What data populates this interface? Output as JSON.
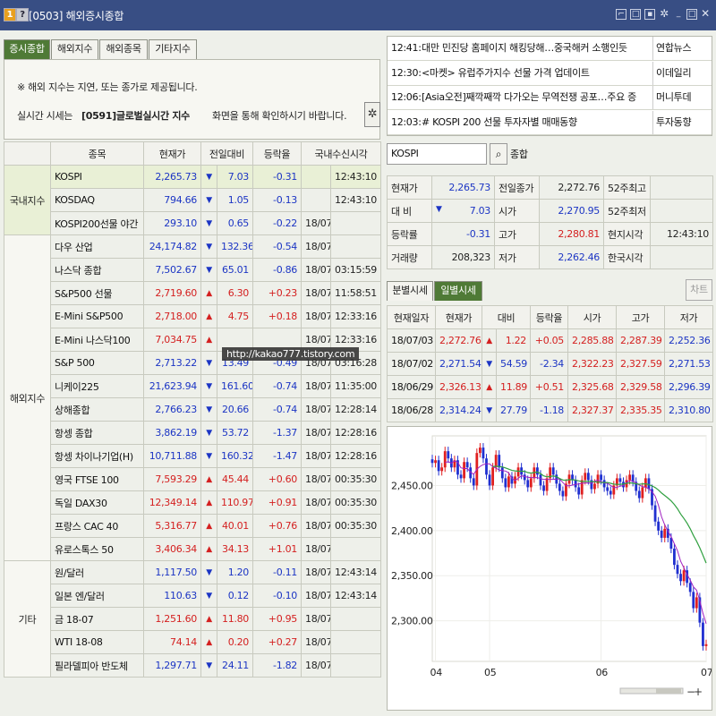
{
  "window": {
    "badge1": "1",
    "badge2": "?",
    "title": "[0503] 해외증시종합",
    "icons": [
      "pin-icon",
      "copy-icon",
      "save-icon",
      "settings-icon",
      "minimize-icon",
      "maximize-icon",
      "close-icon"
    ]
  },
  "tabs": [
    "증시종합",
    "해외지수",
    "해외종목",
    "기타지수"
  ],
  "notice": {
    "line1": "※ 해외 지수는 지연, 또는 종가로 제공됩니다.",
    "line2_prefix": "실시간 시세는",
    "line2_code": "[0591]글로벌실시간 지수",
    "line2_suffix": "화면을 통해 확인하시기 바랍니다."
  },
  "table": {
    "headers": [
      "종목",
      "현재가",
      "전일대비",
      "등락율",
      "국내수신시각"
    ],
    "groups": [
      {
        "label": "국내지수",
        "rows": [
          {
            "name": "KOSPI",
            "price": "2,265.73",
            "dir": "down",
            "change": "7.03",
            "rate": "-0.31",
            "date": "",
            "time": "12:43:10"
          },
          {
            "name": "KOSDAQ",
            "price": "794.66",
            "dir": "down",
            "change": "1.05",
            "rate": "-0.13",
            "date": "",
            "time": "12:43:10"
          },
          {
            "name": "KOSPI200선물 야간",
            "price": "293.10",
            "dir": "down",
            "change": "0.65",
            "rate": "-0.22",
            "date": "18/07/03",
            "time": ""
          }
        ]
      },
      {
        "label": "해외지수",
        "rows": [
          {
            "name": "다우 산업",
            "price": "24,174.82",
            "dir": "down",
            "change": "132.36",
            "rate": "-0.54",
            "date": "18/07/03",
            "time": ""
          },
          {
            "name": "나스닥 종합",
            "price": "7,502.67",
            "dir": "down",
            "change": "65.01",
            "rate": "-0.86",
            "date": "18/07/04",
            "time": "03:15:59"
          },
          {
            "name": "S&P500 선물",
            "price": "2,719.60",
            "dir": "up",
            "change": "6.30",
            "rate": "+0.23",
            "date": "18/07/04",
            "time": "11:58:51"
          },
          {
            "name": "E-Mini S&P500",
            "price": "2,718.00",
            "dir": "up",
            "change": "4.75",
            "rate": "+0.18",
            "date": "18/07/04",
            "time": "12:33:16"
          },
          {
            "name": "E-Mini 나스닥100",
            "price": "7,034.75",
            "dir": "up",
            "change": "",
            "rate": "",
            "date": "18/07/04",
            "time": "12:33:16"
          },
          {
            "name": "S&P 500",
            "price": "2,713.22",
            "dir": "down",
            "change": "13.49",
            "rate": "-0.49",
            "date": "18/07/04",
            "time": "03:16:28"
          },
          {
            "name": "니케이225",
            "price": "21,623.94",
            "dir": "down",
            "change": "161.60",
            "rate": "-0.74",
            "date": "18/07/04",
            "time": "11:35:00"
          },
          {
            "name": "상해종합",
            "price": "2,766.23",
            "dir": "down",
            "change": "20.66",
            "rate": "-0.74",
            "date": "18/07/04",
            "time": "12:28:14"
          },
          {
            "name": "항셍 종합",
            "price": "3,862.19",
            "dir": "down",
            "change": "53.72",
            "rate": "-1.37",
            "date": "18/07/04",
            "time": "12:28:16"
          },
          {
            "name": "항셍 차이나기업(H)",
            "price": "10,711.88",
            "dir": "down",
            "change": "160.32",
            "rate": "-1.47",
            "date": "18/07/04",
            "time": "12:28:16"
          },
          {
            "name": "영국 FTSE 100",
            "price": "7,593.29",
            "dir": "up",
            "change": "45.44",
            "rate": "+0.60",
            "date": "18/07/04",
            "time": "00:35:30"
          },
          {
            "name": "독일 DAX30",
            "price": "12,349.14",
            "dir": "up",
            "change": "110.97",
            "rate": "+0.91",
            "date": "18/07/04",
            "time": "00:35:30"
          },
          {
            "name": "프랑스 CAC 40",
            "price": "5,316.77",
            "dir": "up",
            "change": "40.01",
            "rate": "+0.76",
            "date": "18/07/04",
            "time": "00:35:30"
          },
          {
            "name": "유로스톡스 50",
            "price": "3,406.34",
            "dir": "up",
            "change": "34.13",
            "rate": "+1.01",
            "date": "18/07/03",
            "time": ""
          }
        ]
      },
      {
        "label": "기타",
        "rows": [
          {
            "name": "원/달러",
            "price": "1,117.50",
            "dir": "down",
            "change": "1.20",
            "rate": "-0.11",
            "date": "18/07/04",
            "time": "12:43:14"
          },
          {
            "name": "일본 엔/달러",
            "price": "110.63",
            "dir": "down",
            "change": "0.12",
            "rate": "-0.10",
            "date": "18/07/04",
            "time": "12:43:14"
          },
          {
            "name": "금 18-07",
            "price": "1,251.60",
            "dir": "up",
            "change": "11.80",
            "rate": "+0.95",
            "date": "18/07/03",
            "time": ""
          },
          {
            "name": "WTI 18-08",
            "price": "74.14",
            "dir": "up",
            "change": "0.20",
            "rate": "+0.27",
            "date": "18/07/03",
            "time": ""
          },
          {
            "name": "필라델피아 반도체",
            "price": "1,297.71",
            "dir": "down",
            "change": "24.11",
            "rate": "-1.82",
            "date": "18/07/03",
            "time": ""
          }
        ]
      }
    ]
  },
  "watermark": "http://kakao777.tistory.com",
  "news": [
    {
      "time": "12:41:",
      "title": "대만 민진당 홈페이지 해킹당해…중국해커 소행인듯",
      "source": "연합뉴스"
    },
    {
      "time": "12:30:",
      "title": "<마켓> 유럽주가지수 선물 가격 업데이트",
      "source": "이데일리"
    },
    {
      "time": "12:06:",
      "title": "[Asia오전]째깍째깍 다가오는 무역전쟁 공포…주요 증",
      "source": "머니투데"
    },
    {
      "time": "12:03:",
      "title": "# KOSPI 200 선물 투자자별 매매동향",
      "source": "투자동향"
    }
  ],
  "search": {
    "value": "KOSPI",
    "label": "종합"
  },
  "quote": {
    "rows": [
      [
        {
          "l": "현재가"
        },
        {
          "v": "2,265.73",
          "c": "dn"
        },
        {
          "l": "전일종가"
        },
        {
          "v": "2,272.76",
          "c": "neu"
        },
        {
          "l": "52주최고"
        },
        {
          "v": "",
          "c": "neu"
        }
      ],
      [
        {
          "l": "대 비"
        },
        {
          "v": "7.03",
          "c": "dn",
          "arrow": "▼"
        },
        {
          "l": "시가"
        },
        {
          "v": "2,270.95",
          "c": "dn"
        },
        {
          "l": "52주최저"
        },
        {
          "v": "",
          "c": "neu"
        }
      ],
      [
        {
          "l": "등락률"
        },
        {
          "v": "-0.31",
          "c": "dn"
        },
        {
          "l": "고가"
        },
        {
          "v": "2,280.81",
          "c": "up"
        },
        {
          "l": "현지시각"
        },
        {
          "v": "12:43:10",
          "c": "neu"
        }
      ],
      [
        {
          "l": "거래량"
        },
        {
          "v": "208,323",
          "c": "neu"
        },
        {
          "l": "저가"
        },
        {
          "v": "2,262.46",
          "c": "dn"
        },
        {
          "l": "한국시각"
        },
        {
          "v": "",
          "c": "neu"
        }
      ]
    ]
  },
  "subtabs": [
    "분별시세",
    "일별시세"
  ],
  "chart_button": "차트",
  "daily": {
    "headers": [
      "현재일자",
      "현재가",
      "대비",
      "등락율",
      "시가",
      "고가",
      "저가"
    ],
    "rows": [
      {
        "date": "18/07/03",
        "price": "2,272.76",
        "pc": "up",
        "dir": "up",
        "change": "1.22",
        "rate": "+0.05",
        "open": "2,285.88",
        "high": "2,287.39",
        "low": "2,252.36"
      },
      {
        "date": "18/07/02",
        "price": "2,271.54",
        "pc": "dn",
        "dir": "down",
        "change": "54.59",
        "rate": "-2.34",
        "open": "2,322.23",
        "high": "2,327.59",
        "low": "2,271.53"
      },
      {
        "date": "18/06/29",
        "price": "2,326.13",
        "pc": "up",
        "dir": "up",
        "change": "11.89",
        "rate": "+0.51",
        "open": "2,325.68",
        "high": "2,329.58",
        "low": "2,296.39"
      },
      {
        "date": "18/06/28",
        "price": "2,314.24",
        "pc": "dn",
        "dir": "down",
        "change": "27.79",
        "rate": "-1.18",
        "open": "2,327.37",
        "high": "2,335.35",
        "low": "2,310.80"
      }
    ]
  },
  "chart_data": {
    "type": "candlestick",
    "ylabels": [
      "2,450.00",
      "2,400.00",
      "2,300.00",
      "2,350.00"
    ],
    "yticks": [
      2450,
      2400,
      2350,
      2300
    ],
    "ylim": [
      2255,
      2505
    ],
    "xlabels": [
      "04",
      "05",
      "06",
      "07"
    ],
    "xlabel_index": [
      1,
      18,
      53,
      86
    ],
    "series_colors": {
      "up": "#e02020",
      "down": "#2030d0",
      "ma5": "#a020c0",
      "ma20": "#30a040"
    },
    "closes": [
      2475,
      2478,
      2466,
      2470,
      2488,
      2480,
      2470,
      2478,
      2462,
      2458,
      2476,
      2470,
      2458,
      2450,
      2486,
      2492,
      2480,
      2462,
      2450,
      2470,
      2484,
      2470,
      2458,
      2448,
      2460,
      2452,
      2460,
      2470,
      2462,
      2456,
      2448,
      2458,
      2470,
      2462,
      2450,
      2444,
      2458,
      2470,
      2462,
      2452,
      2444,
      2438,
      2452,
      2462,
      2456,
      2448,
      2440,
      2456,
      2464,
      2456,
      2446,
      2452,
      2462,
      2456,
      2448,
      2444,
      2440,
      2450,
      2458,
      2454,
      2448,
      2456,
      2462,
      2454,
      2444,
      2436,
      2448,
      2458,
      2446,
      2428,
      2410,
      2400,
      2392,
      2402,
      2392,
      2380,
      2362,
      2352,
      2344,
      2356,
      2342,
      2332,
      2314,
      2326,
      2298,
      2272,
      2274
    ]
  }
}
